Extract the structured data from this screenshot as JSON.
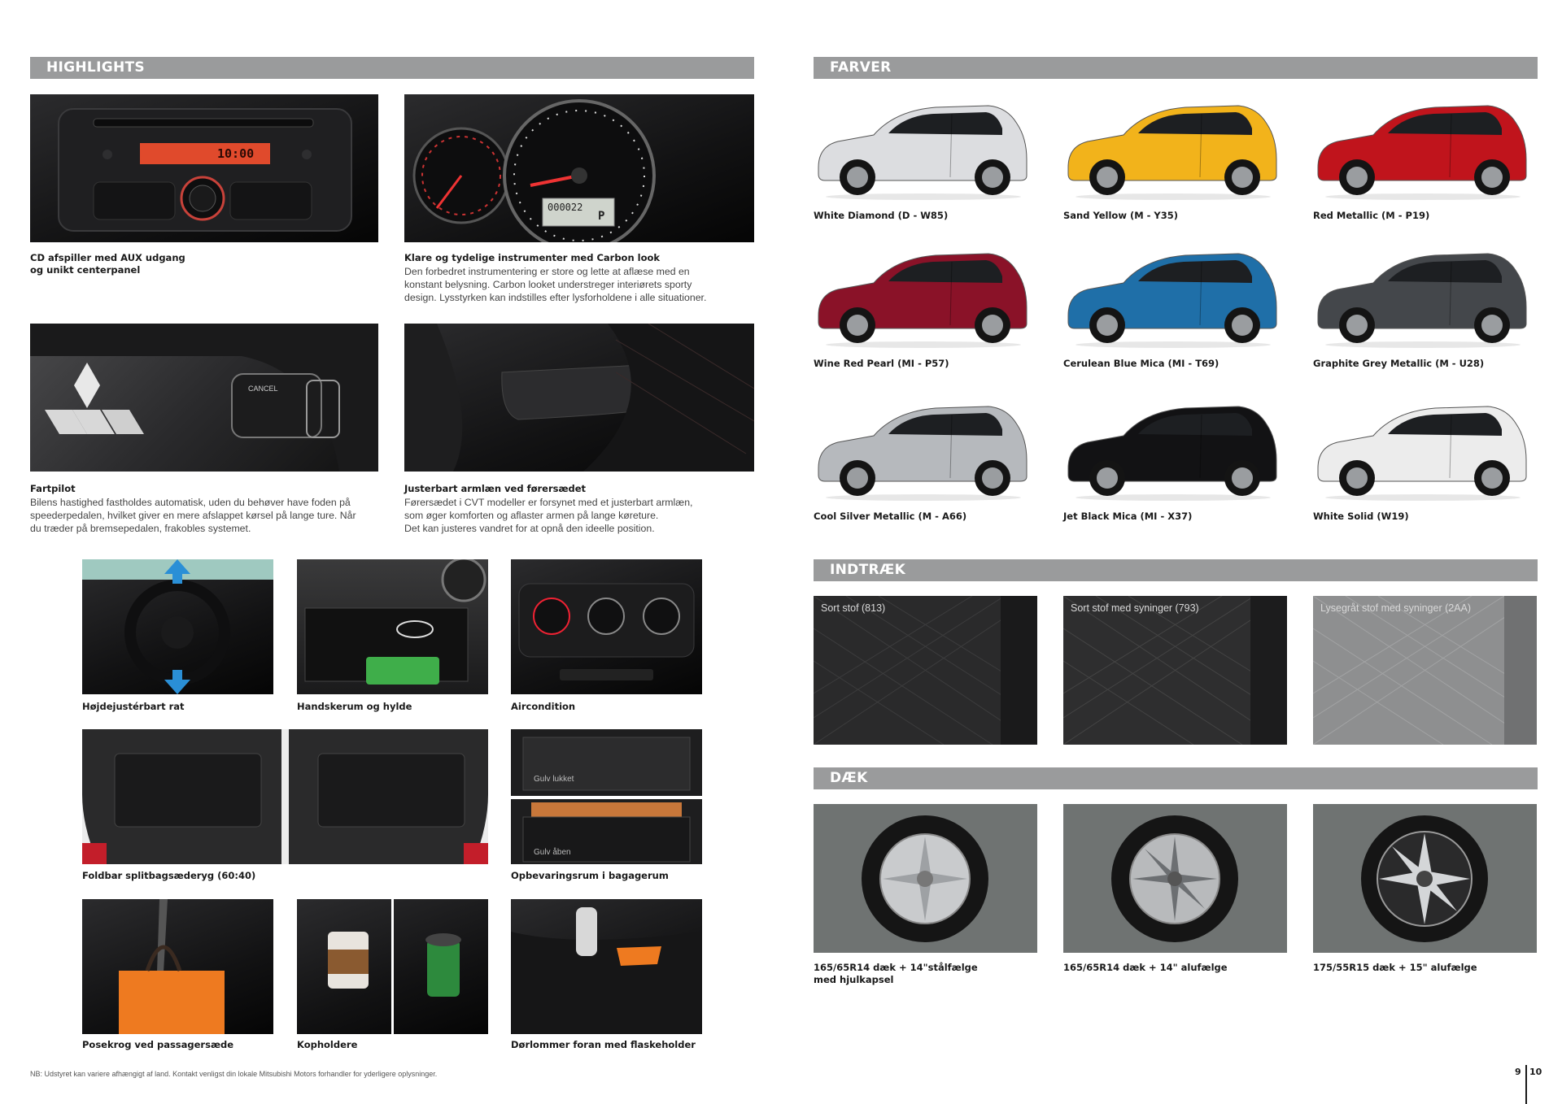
{
  "left": {
    "section_title": "HIGHLIGHTS",
    "features": [
      {
        "title": "CD afspiller med AUX udgang",
        "title2": "og unikt centerpanel",
        "text": ""
      },
      {
        "title": "Klare og tydelige instrumenter med Carbon look",
        "title2": "",
        "text1": "Den forbedret instrumentering er store og lette at aflæse med en",
        "text2": "konstant belysning. Carbon looket understreger interiørets sporty",
        "text3": "design. Lysstyrken kan indstilles efter lysforholdene i alle situationer."
      },
      {
        "title": "Fartpilot",
        "title2": "",
        "text1": "Bilens hastighed fastholdes automatisk, uden du behøver have foden på",
        "text2": "speederpedalen, hvilket giver en mere afslappet kørsel på lange ture. Når",
        "text3": "du træder på bremsepedalen, frakobles systemet."
      },
      {
        "title": "Justerbart armlæn ved førersædet",
        "title2": "",
        "text1": "Førersædet i CVT modeller er forsynet med et justerbart armlæn,",
        "text2": "som øger komforten og aflaster armen på lange køreture.",
        "text3": "Det kan justeres vandret for at opnå den ideelle position."
      }
    ],
    "radio_display": "10:00",
    "odometer": "000022",
    "gear": "P",
    "cruise_cancel": "CANCEL",
    "small_features": [
      "Højdejustérbart rat",
      "Handskerum og hylde",
      "Aircondition",
      "Foldbar splitbagsæderyg (60:40)",
      "Opbevaringsrum i bagagerum",
      "Posekrog ved passagersæde",
      "Kopholdere",
      "Dørlommer foran med flaskeholder"
    ],
    "floor_closed": "Gulv lukket",
    "floor_open": "Gulv åben",
    "footnote": "NB: Udstyret kan variere afhængigt af land. Kontakt venligst din lokale Mitsubishi Motors forhandler for yderligere oplysninger."
  },
  "right": {
    "colors_title": "FARVER",
    "colors": [
      {
        "label": "White Diamond (D - W85)",
        "hex": "#dcdde0"
      },
      {
        "label": "Sand Yellow (M - Y35)",
        "hex": "#f2b31b"
      },
      {
        "label": "Red Metallic (M - P19)",
        "hex": "#c0141c"
      },
      {
        "label": "Wine Red Pearl (MI - P57)",
        "hex": "#8a1228"
      },
      {
        "label": "Cerulean Blue Mica (MI - T69)",
        "hex": "#1f6fa8"
      },
      {
        "label": "Graphite Grey Metallic (M - U28)",
        "hex": "#44474b"
      },
      {
        "label": "Cool Silver Metallic (M - A66)",
        "hex": "#b6b9bd"
      },
      {
        "label": "Jet Black Mica (MI - X37)",
        "hex": "#121214"
      },
      {
        "label": "White Solid (W19)",
        "hex": "#ececec"
      }
    ],
    "upholstery_title": "INDTRÆK",
    "upholstery": [
      {
        "label": "Sort stof (813)",
        "hex": "#2a2a2b"
      },
      {
        "label": "Sort stof med syninger (793)",
        "hex": "#2e2e2f"
      },
      {
        "label": "Lysegråt stof med syninger (2AA)",
        "hex": "#8e8f90"
      }
    ],
    "tyres_title": "DÆK",
    "tyres": [
      {
        "line1": "165/65R14 dæk + 14\"stålfælge",
        "line2": "med hjulkapsel"
      },
      {
        "line1": "165/65R14 dæk + 14\" alufælge",
        "line2": ""
      },
      {
        "line1": "175/55R15 dæk + 15\" alufælge",
        "line2": ""
      }
    ]
  },
  "page_left": "9",
  "page_right": "10"
}
